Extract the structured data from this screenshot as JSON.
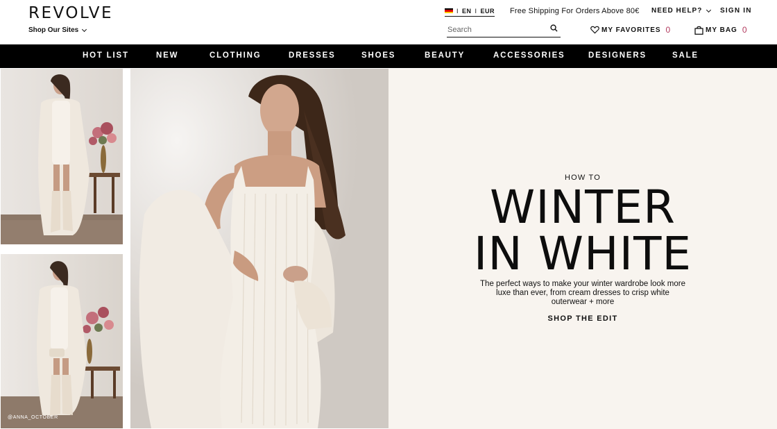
{
  "header": {
    "logo": "REVOLVE",
    "shop_sites": "Shop Our Sites",
    "locale": {
      "sep1": "I",
      "language": "EN",
      "sep2": "I",
      "currency": "EUR"
    },
    "shipping": "Free Shipping For Orders Above 80€",
    "need_help": "NEED HELP?",
    "sign_in": "SIGN IN",
    "search_placeholder": "Search",
    "favorites": {
      "label": "MY FAVORITES",
      "count": "0"
    },
    "bag": {
      "label": "MY BAG",
      "count": "0"
    }
  },
  "nav": {
    "items": [
      "HOT LIST",
      "NEW",
      "CLOTHING",
      "DRESSES",
      "SHOES",
      "BEAUTY",
      "ACCESSORIES",
      "DESIGNERS",
      "SALE"
    ]
  },
  "hero": {
    "credit": "@ANNA_OCTOBER",
    "eyebrow": "HOW TO",
    "headline_line1": "WINTER",
    "headline_line2": "IN WHITE",
    "subcopy": "The perfect ways to make your winter wardrobe look more luxe than ever, from cream dresses to crisp white outerwear + more",
    "cta": "SHOP THE EDIT"
  },
  "colors": {
    "nav_bg": "#000000",
    "count_accent": "#b23a5e",
    "editorial_bg": "#f8f4ef"
  },
  "icons": [
    "chevron-down-icon",
    "flag-germany-icon",
    "search-icon",
    "heart-icon",
    "bag-icon"
  ]
}
